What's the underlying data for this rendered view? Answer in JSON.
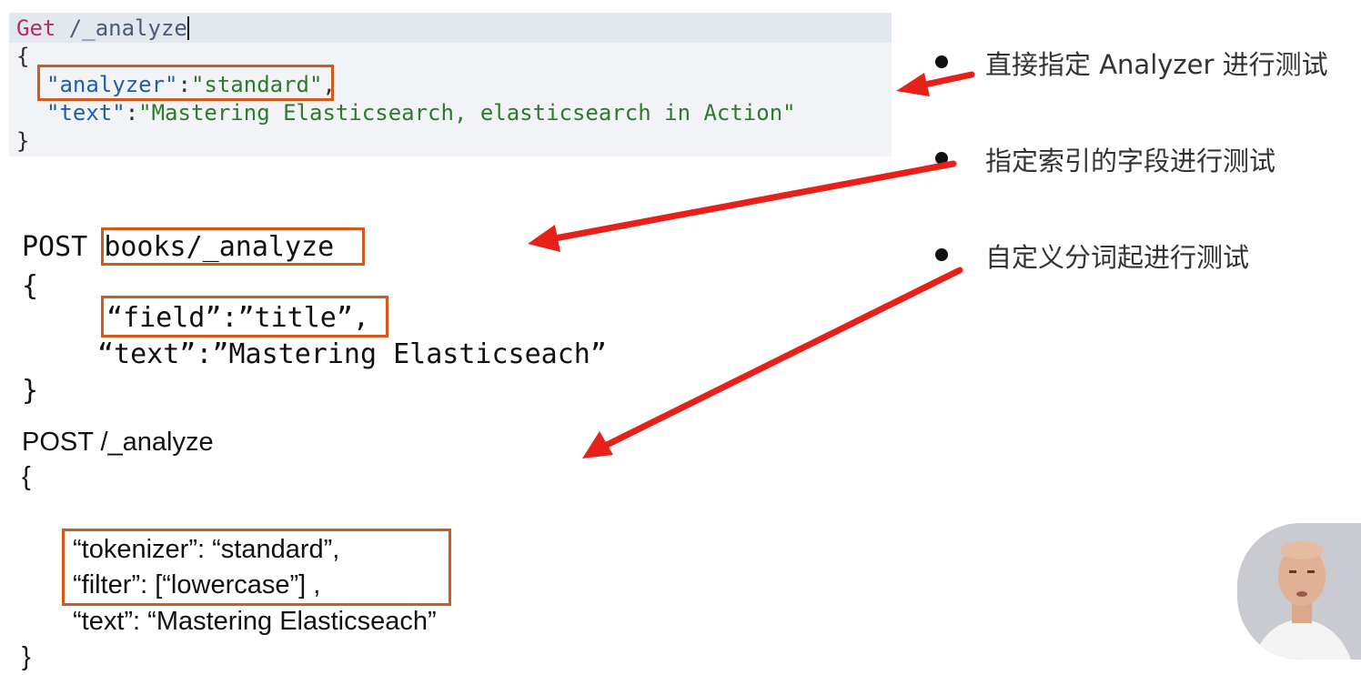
{
  "panel1": {
    "method": "Get",
    "path": " /_analyze",
    "open_brace": "{",
    "analyzer_key": "\"analyzer\"",
    "colon": ":",
    "analyzer_value": "\"standard\"",
    "comma": ",",
    "text_key": "\"text\"",
    "text_value": "\"Mastering Elasticsearch, elasticsearch in Action\"",
    "close_brace": "}"
  },
  "panel2": {
    "method": "POST",
    "path": "books/_analyze",
    "open_brace": "{",
    "field_line": "“field”:”title”,",
    "text_line": "“text”:”Mastering Elasticseach”",
    "close_brace": "}"
  },
  "panel3": {
    "request_line": "POST /_analyze",
    "open_brace": "{",
    "tokenizer_line": "“tokenizer”: “standard”,",
    "filter_line": "“filter”: [“lowercase”] ,",
    "text_line": "“text”: “Mastering Elasticseach”",
    "close_brace": "}"
  },
  "bullets": [
    {
      "text": "直接指定 Analyzer 进行测试"
    },
    {
      "text": "指定索引的字段进行测试"
    },
    {
      "text": "自定义分词起进行测试"
    }
  ],
  "colors": {
    "highlight_box": "#d35a1c",
    "arrow": "#e8201a"
  },
  "icons": {
    "presenter": "presenter-video-thumbnail"
  }
}
